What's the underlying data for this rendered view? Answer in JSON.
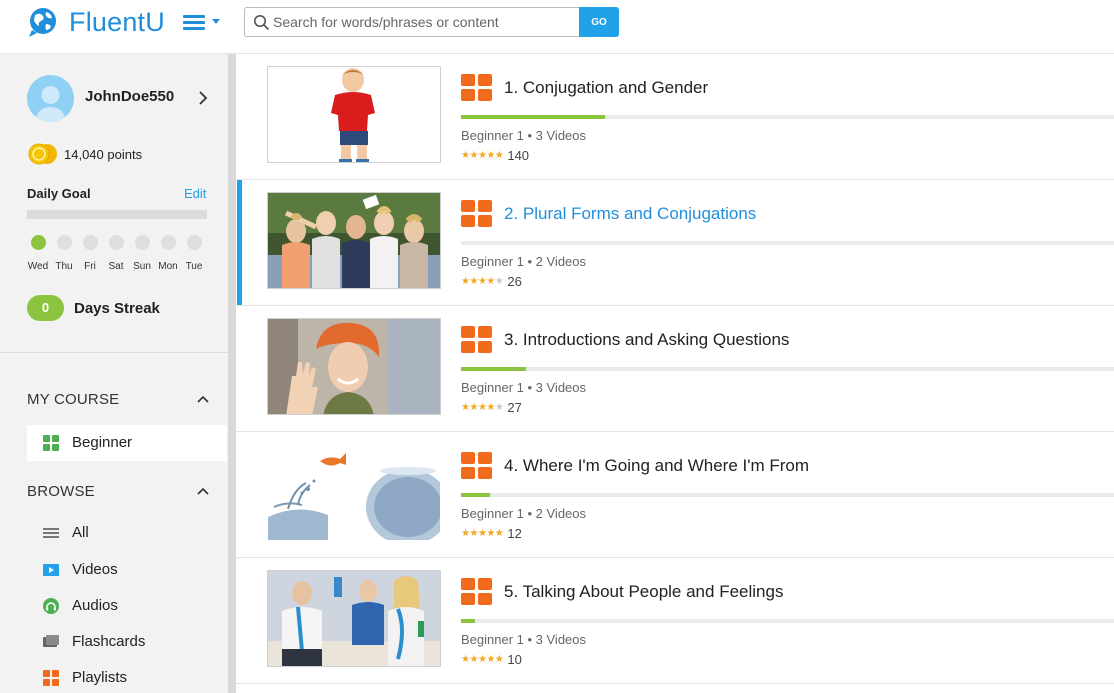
{
  "brand": {
    "name": "FluentU",
    "accent": "#1f8fdc",
    "go_accent": "#21a2e8",
    "lesson_orange": "#f26b1d",
    "progress_green": "#8bc53f"
  },
  "search": {
    "placeholder": "Search for words/phrases or content",
    "value": "",
    "go_label": "GO"
  },
  "sidebar": {
    "user": {
      "name": "JohnDoe550",
      "points": "14,040 points"
    },
    "daily_goal": {
      "label": "Daily Goal",
      "edit_label": "Edit",
      "progress": 0.0,
      "days": [
        {
          "label": "Wed",
          "done": true
        },
        {
          "label": "Thu",
          "done": false
        },
        {
          "label": "Fri",
          "done": false
        },
        {
          "label": "Sat",
          "done": false
        },
        {
          "label": "Sun",
          "done": false
        },
        {
          "label": "Mon",
          "done": false
        },
        {
          "label": "Tue",
          "done": false
        }
      ]
    },
    "streak": {
      "count": "0",
      "label": "Days Streak"
    },
    "my_course": {
      "heading": "MY COURSE",
      "item": "Beginner"
    },
    "browse": {
      "heading": "BROWSE",
      "items": [
        {
          "label": "All",
          "icon": "list-icon"
        },
        {
          "label": "Videos",
          "icon": "video-icon"
        },
        {
          "label": "Audios",
          "icon": "headphones-icon"
        },
        {
          "label": "Flashcards",
          "icon": "flashcards-icon"
        },
        {
          "label": "Playlists",
          "icon": "playlists-icon"
        }
      ]
    }
  },
  "lessons": [
    {
      "title": "1. Conjugation and Gender",
      "meta": "Beginner 1 • 3 Videos",
      "stars": 4.5,
      "star_text": "★★★★★",
      "rating_count": "140",
      "progress": 0.22,
      "active": false,
      "thumb": "boy-red-shirt"
    },
    {
      "title": "2. Plural Forms and Conjugations",
      "meta": "Beginner 1 • 2 Videos",
      "stars": 4,
      "star_text": "★★★★★",
      "rating_count": "26",
      "progress": 0.0,
      "active": true,
      "thumb": "group-of-women"
    },
    {
      "title": "3. Introductions and Asking Questions",
      "meta": "Beginner 1 • 3 Videos",
      "stars": 4,
      "star_text": "★★★★★",
      "rating_count": "27",
      "progress": 0.1,
      "active": false,
      "thumb": "waving-woman"
    },
    {
      "title": "4. Where I'm Going and Where I'm From",
      "meta": "Beginner 1 • 2 Videos",
      "stars": 4.5,
      "star_text": "★★★★★",
      "rating_count": "12",
      "progress": 0.045,
      "active": false,
      "thumb": "jumping-goldfish"
    },
    {
      "title": "5. Talking About People and Feelings",
      "meta": "Beginner 1 • 3 Videos",
      "stars": 4.5,
      "star_text": "★★★★★",
      "rating_count": "10",
      "progress": 0.022,
      "active": false,
      "thumb": "party-people"
    }
  ]
}
